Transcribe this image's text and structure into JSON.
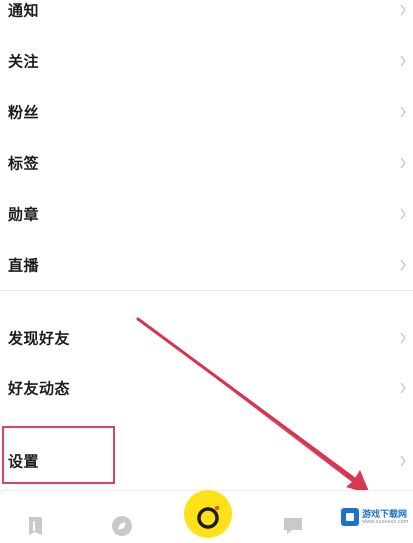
{
  "menu": {
    "items": [
      {
        "label": "通知"
      },
      {
        "label": "关注"
      },
      {
        "label": "粉丝"
      },
      {
        "label": "标签"
      },
      {
        "label": "勋章"
      },
      {
        "label": "直播"
      },
      {
        "label": "发现好友"
      },
      {
        "label": "好友动态"
      },
      {
        "label": "设置"
      }
    ]
  },
  "tabbar": {
    "tabs": [
      {
        "icon": "bookmark-icon"
      },
      {
        "icon": "compass-icon"
      },
      {
        "icon": "camera-icon",
        "accent": "#ffe11a"
      },
      {
        "icon": "message-icon"
      }
    ]
  },
  "annotation": {
    "highlight_color": "#d94560",
    "highlighted_item": "设置"
  },
  "watermark": {
    "title": "游戏下载网",
    "subtitle": "www.xxxxxxx.com"
  }
}
